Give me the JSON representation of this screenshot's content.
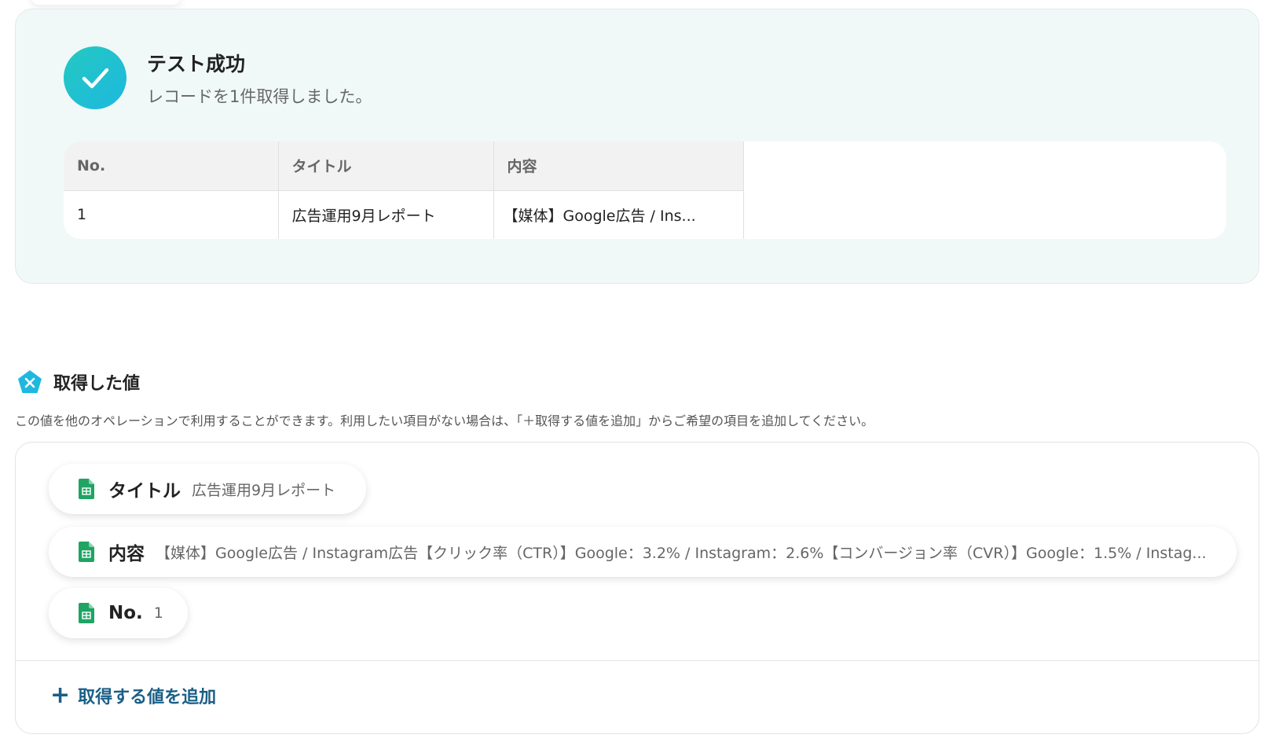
{
  "result": {
    "title": "テスト成功",
    "subtitle": "レコードを1件取得しました。",
    "table": {
      "headers": [
        "No.",
        "タイトル",
        "内容"
      ],
      "rows": [
        [
          "1",
          "広告運用9月レポート",
          "【媒体】Google広告 / Ins..."
        ]
      ]
    }
  },
  "values_section": {
    "title": "取得した値",
    "description": "この値を他のオペレーションで利用することができます。利用したい項目がない場合は、「＋取得する値を追加」からご希望の項目を追加してください。",
    "items": [
      {
        "key": "タイトル",
        "value": "広告運用9月レポート",
        "icon": "spreadsheet-icon"
      },
      {
        "key": "内容",
        "value": "【媒体】Google広告 / Instagram広告【クリック率（CTR）】Google：3.2% / Instagram：2.6%【コンバージョン率（CVR）】Google：1.5% / Instag...",
        "icon": "spreadsheet-icon"
      },
      {
        "key": "No.",
        "value": "1",
        "icon": "spreadsheet-icon"
      }
    ],
    "add_button_label": "取得する値を追加"
  },
  "colors": {
    "accent": "#1a5f86",
    "success_gradient_start": "#23c9c1",
    "success_gradient_end": "#1eb8df",
    "sheet_green": "#1fa463"
  }
}
